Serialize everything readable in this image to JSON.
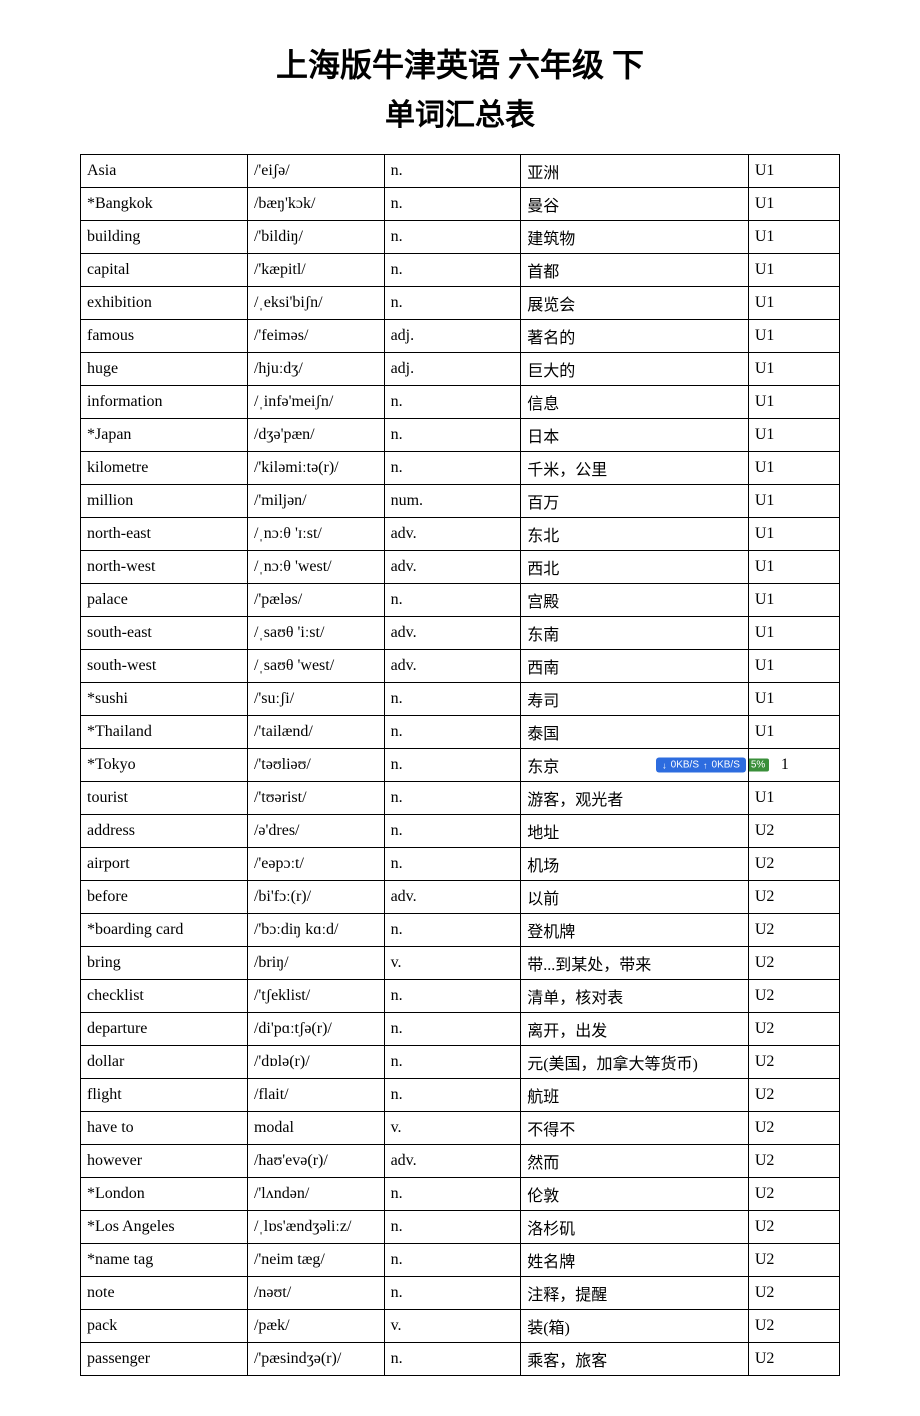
{
  "title": "上海版牛津英语 六年级 下",
  "subtitle": "单词汇总表",
  "overlay": {
    "down_label": "0KB/S",
    "up_label": "0KB/S",
    "percent": "5%"
  },
  "rows": [
    {
      "word": "Asia",
      "ipa": "/'eiʃə/",
      "pos": "n.",
      "cn": "亚洲",
      "unit": "U1",
      "badge": false
    },
    {
      "word": "*Bangkok",
      "ipa": "/bæŋ'kɔk/",
      "pos": "n.",
      "cn": "曼谷",
      "unit": "U1",
      "badge": false
    },
    {
      "word": "building",
      "ipa": "/'bildiŋ/",
      "pos": "n.",
      "cn": "建筑物",
      "unit": "U1",
      "badge": false
    },
    {
      "word": "capital",
      "ipa": "/'kæpitl/",
      "pos": "n.",
      "cn": "首都",
      "unit": "U1",
      "badge": false
    },
    {
      "word": "exhibition",
      "ipa": "/ˌeksi'biʃn/",
      "pos": "n.",
      "cn": "展览会",
      "unit": "U1",
      "badge": false
    },
    {
      "word": "famous",
      "ipa": "/'feiməs/",
      "pos": "adj.",
      "cn": "著名的",
      "unit": "U1",
      "badge": false
    },
    {
      "word": "huge",
      "ipa": "/hjuːdʒ/",
      "pos": "adj.",
      "cn": "巨大的",
      "unit": "U1",
      "badge": false
    },
    {
      "word": "information",
      "ipa": "/ˌinfə'meiʃn/",
      "pos": "n.",
      "cn": "信息",
      "unit": "U1",
      "badge": false
    },
    {
      "word": "*Japan",
      "ipa": "/dʒə'pæn/",
      "pos": "n.",
      "cn": "日本",
      "unit": "U1",
      "badge": false
    },
    {
      "word": "kilometre",
      "ipa": "/'kiləmiːtə(r)/",
      "pos": "n.",
      "cn": "千米，公里",
      "unit": "U1",
      "badge": false
    },
    {
      "word": "million",
      "ipa": "/'miljən/",
      "pos": "num.",
      "cn": "百万",
      "unit": "U1",
      "badge": false
    },
    {
      "word": "north-east",
      "ipa": "/ˌnɔːθ 'ɪːst/",
      "pos": "adv.",
      "cn": "东北",
      "unit": "U1",
      "badge": false
    },
    {
      "word": "north-west",
      "ipa": "/ˌnɔːθ 'west/",
      "pos": "adv.",
      "cn": "西北",
      "unit": "U1",
      "badge": false
    },
    {
      "word": "palace",
      "ipa": "/'pæləs/",
      "pos": "n.",
      "cn": "宫殿",
      "unit": "U1",
      "badge": false
    },
    {
      "word": "south-east",
      "ipa": "/ˌsaʊθ 'iːst/",
      "pos": "adv.",
      "cn": "东南",
      "unit": "U1",
      "badge": false
    },
    {
      "word": "south-west",
      "ipa": "/ˌsaʊθ 'west/",
      "pos": "adv.",
      "cn": "西南",
      "unit": "U1",
      "badge": false
    },
    {
      "word": "*sushi",
      "ipa": "/'suːʃi/",
      "pos": "n.",
      "cn": "寿司",
      "unit": "U1",
      "badge": false
    },
    {
      "word": "*Thailand",
      "ipa": "/'tailænd/",
      "pos": "n.",
      "cn": "泰国",
      "unit": "U1",
      "badge": false
    },
    {
      "word": "*Tokyo",
      "ipa": "/'təʊliəʊ/",
      "pos": "n.",
      "cn": "东京",
      "unit": "1",
      "badge": true
    },
    {
      "word": "tourist",
      "ipa": "/'tʊərist/",
      "pos": "n.",
      "cn": "游客，观光者",
      "unit": "U1",
      "badge": false
    },
    {
      "word": "address",
      "ipa": "/ə'dres/",
      "pos": "n.",
      "cn": "地址",
      "unit": "U2",
      "badge": false
    },
    {
      "word": "airport",
      "ipa": "/'eəpɔːt/",
      "pos": "n.",
      "cn": "机场",
      "unit": "U2",
      "badge": false
    },
    {
      "word": "before",
      "ipa": "/bi'fɔː(r)/",
      "pos": "adv.",
      "cn": "以前",
      "unit": "U2",
      "badge": false
    },
    {
      "word": "*boarding card",
      "ipa": "/'bɔːdiŋ kɑːd/",
      "pos": "n.",
      "cn": "登机牌",
      "unit": "U2",
      "badge": false
    },
    {
      "word": "bring",
      "ipa": "/briŋ/",
      "pos": "v.",
      "cn": "带...到某处，带来",
      "unit": "U2",
      "badge": false
    },
    {
      "word": "checklist",
      "ipa": "/'tʃeklist/",
      "pos": "n.",
      "cn": "清单，核对表",
      "unit": "U2",
      "badge": false
    },
    {
      "word": "departure",
      "ipa": "/di'pɑːtʃə(r)/",
      "pos": "n.",
      "cn": "离开，出发",
      "unit": "U2",
      "badge": false
    },
    {
      "word": "dollar",
      "ipa": "/'dɒlə(r)/",
      "pos": "n.",
      "cn": "元(美国，加拿大等货币)",
      "unit": "U2",
      "badge": false
    },
    {
      "word": "flight",
      "ipa": "/flait/",
      "pos": "n.",
      "cn": "航班",
      "unit": "U2",
      "badge": false
    },
    {
      "word": "have to",
      "ipa": "modal",
      "pos": "v.",
      "cn": "不得不",
      "unit": "U2",
      "badge": false
    },
    {
      "word": "however",
      "ipa": "/haʊ'evə(r)/",
      "pos": "adv.",
      "cn": "然而",
      "unit": "U2",
      "badge": false
    },
    {
      "word": "*London",
      "ipa": "/'lʌndən/",
      "pos": "n.",
      "cn": "伦敦",
      "unit": "U2",
      "badge": false
    },
    {
      "word": "*Los Angeles",
      "ipa": "/ˌlɒs'ændʒəliːz/",
      "pos": "n.",
      "cn": "洛杉矶",
      "unit": "U2",
      "badge": false
    },
    {
      "word": "*name tag",
      "ipa": "/'neim tæg/",
      "pos": "n.",
      "cn": "姓名牌",
      "unit": "U2",
      "badge": false
    },
    {
      "word": "note",
      "ipa": "/nəʊt/",
      "pos": "n.",
      "cn": "注释，提醒",
      "unit": "U2",
      "badge": false
    },
    {
      "word": "pack",
      "ipa": "/pæk/",
      "pos": "v.",
      "cn": "装(箱)",
      "unit": "U2",
      "badge": false
    },
    {
      "word": "passenger",
      "ipa": "/'pæsindʒə(r)/",
      "pos": "n.",
      "cn": "乘客，旅客",
      "unit": "U2",
      "badge": false
    }
  ]
}
